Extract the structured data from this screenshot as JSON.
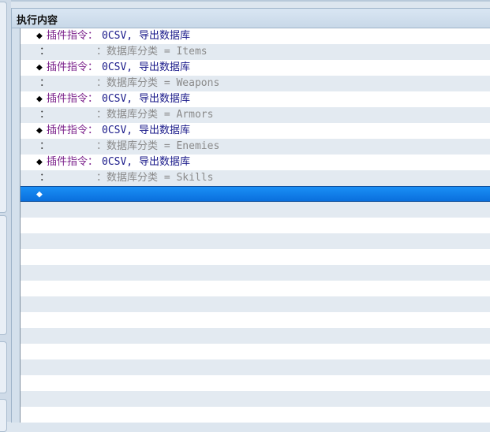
{
  "panel": {
    "title": "执行内容"
  },
  "rows": [
    {
      "type": "command",
      "marker": "◆",
      "name": "插件指令：",
      "value": "0CSV, 导出数据库"
    },
    {
      "type": "continuation",
      "marker": "：",
      "value": "：数据库分类 = Items"
    },
    {
      "type": "command",
      "marker": "◆",
      "name": "插件指令：",
      "value": "0CSV, 导出数据库"
    },
    {
      "type": "continuation",
      "marker": "：",
      "value": "：数据库分类 = Weapons"
    },
    {
      "type": "command",
      "marker": "◆",
      "name": "插件指令：",
      "value": "0CSV, 导出数据库"
    },
    {
      "type": "continuation",
      "marker": "：",
      "value": "：数据库分类 = Armors"
    },
    {
      "type": "command",
      "marker": "◆",
      "name": "插件指令：",
      "value": "0CSV, 导出数据库"
    },
    {
      "type": "continuation",
      "marker": "：",
      "value": "：数据库分类 = Enemies"
    },
    {
      "type": "command",
      "marker": "◆",
      "name": "插件指令：",
      "value": "0CSV, 导出数据库"
    },
    {
      "type": "continuation",
      "marker": "：",
      "value": "：数据库分类 = Skills"
    },
    {
      "type": "empty",
      "marker": "◆",
      "selected": true
    }
  ],
  "colors": {
    "command_name": "#7a1f8a",
    "command_value": "#1a1a8a",
    "continuation": "#8a8a8a",
    "selection": "#0a7be8"
  }
}
